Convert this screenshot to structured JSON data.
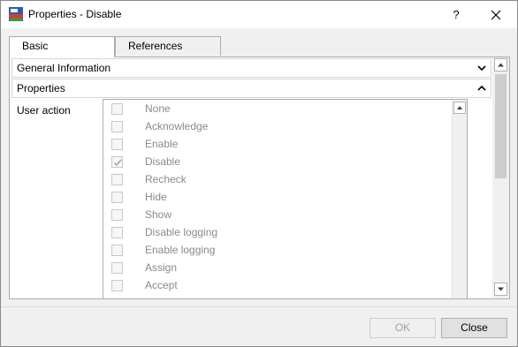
{
  "window": {
    "title": "Properties - Disable",
    "help_label": "?"
  },
  "tabs": [
    {
      "label": "Basic",
      "active": true
    },
    {
      "label": "References",
      "active": false
    }
  ],
  "sections": {
    "general": {
      "label": "General Information",
      "expanded": false
    },
    "properties": {
      "label": "Properties",
      "expanded": true
    }
  },
  "user_action": {
    "label": "User action",
    "options": [
      {
        "label": "None",
        "checked": false
      },
      {
        "label": "Acknowledge",
        "checked": false
      },
      {
        "label": "Enable",
        "checked": false
      },
      {
        "label": "Disable",
        "checked": true
      },
      {
        "label": "Recheck",
        "checked": false
      },
      {
        "label": "Hide",
        "checked": false
      },
      {
        "label": "Show",
        "checked": false
      },
      {
        "label": "Disable logging",
        "checked": false
      },
      {
        "label": "Enable logging",
        "checked": false
      },
      {
        "label": "Assign",
        "checked": false
      },
      {
        "label": "Accept",
        "checked": false
      }
    ]
  },
  "footer": {
    "ok_label": "OK",
    "ok_enabled": false,
    "close_label": "Close"
  }
}
